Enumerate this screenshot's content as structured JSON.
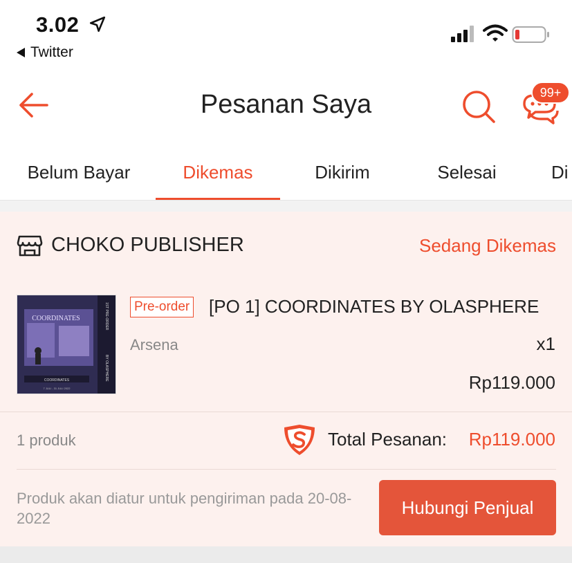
{
  "status_bar": {
    "time": "3.02",
    "back_app_label": "Twitter"
  },
  "header": {
    "title": "Pesanan Saya",
    "chat_badge": "99+"
  },
  "tabs": [
    {
      "label": "Belum Bayar",
      "active": false
    },
    {
      "label": "Dikemas",
      "active": true
    },
    {
      "label": "Dikirim",
      "active": false
    },
    {
      "label": "Selesai",
      "active": false
    },
    {
      "label": "Di",
      "active": false
    }
  ],
  "order": {
    "shop_name": "CHOKO PUBLISHER",
    "status": "Sedang Dikemas",
    "product": {
      "tag": "Pre-order",
      "name": "[PO 1] COORDINATES BY OLASPHERE",
      "variant": "Arsena",
      "quantity": "x1",
      "price": "Rp119.000",
      "image": {
        "title": "COORDINATES",
        "subtitle": "COORDINATES",
        "side_text_1": "1ST PRE-ORDER",
        "side_text_2": "BY OLASPHERE",
        "dates": "7 JULI - 31 JULI 2022"
      }
    },
    "product_count": "1 produk",
    "total_label": "Total Pesanan:",
    "total_value": "Rp119.000",
    "shipping_note": "Produk akan diatur untuk pengiriman pada 20-08-2022",
    "contact_button": "Hubungi Penjual"
  },
  "colors": {
    "accent": "#ee4d2d",
    "card_bg": "#fdf1ee"
  }
}
